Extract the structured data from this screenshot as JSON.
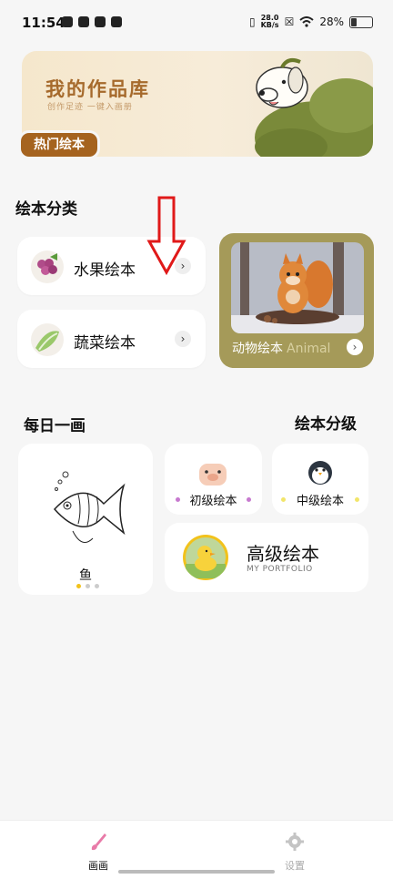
{
  "status_bar": {
    "time": "11:54",
    "net_speed": "28.0",
    "net_unit": "KB/s",
    "battery": "28%"
  },
  "banner": {
    "title": "我的作品库",
    "subtitle": "创作足迹  一键入画册",
    "button": "热门绘本"
  },
  "categories": {
    "title": "绘本分类",
    "items": [
      {
        "label": "水果绘本"
      },
      {
        "label": "蔬菜绘本"
      }
    ],
    "featured": {
      "label": "动物绘本",
      "label_en": "Animal"
    }
  },
  "daily": {
    "title": "每日一画",
    "item_label": "鱼"
  },
  "levels": {
    "title": "绘本分级",
    "beginner": "初级绘本",
    "intermediate": "中级绘本",
    "advanced": {
      "title": "高级绘本",
      "subtitle": "MY PORTFOLIO"
    }
  },
  "tabbar": {
    "draw": "画画",
    "settings": "设置"
  },
  "colors": {
    "brand_brown": "#a5631f",
    "olive": "#a59a59",
    "accent_pink": "#e87aa8",
    "yellow": "#f2c21b"
  }
}
